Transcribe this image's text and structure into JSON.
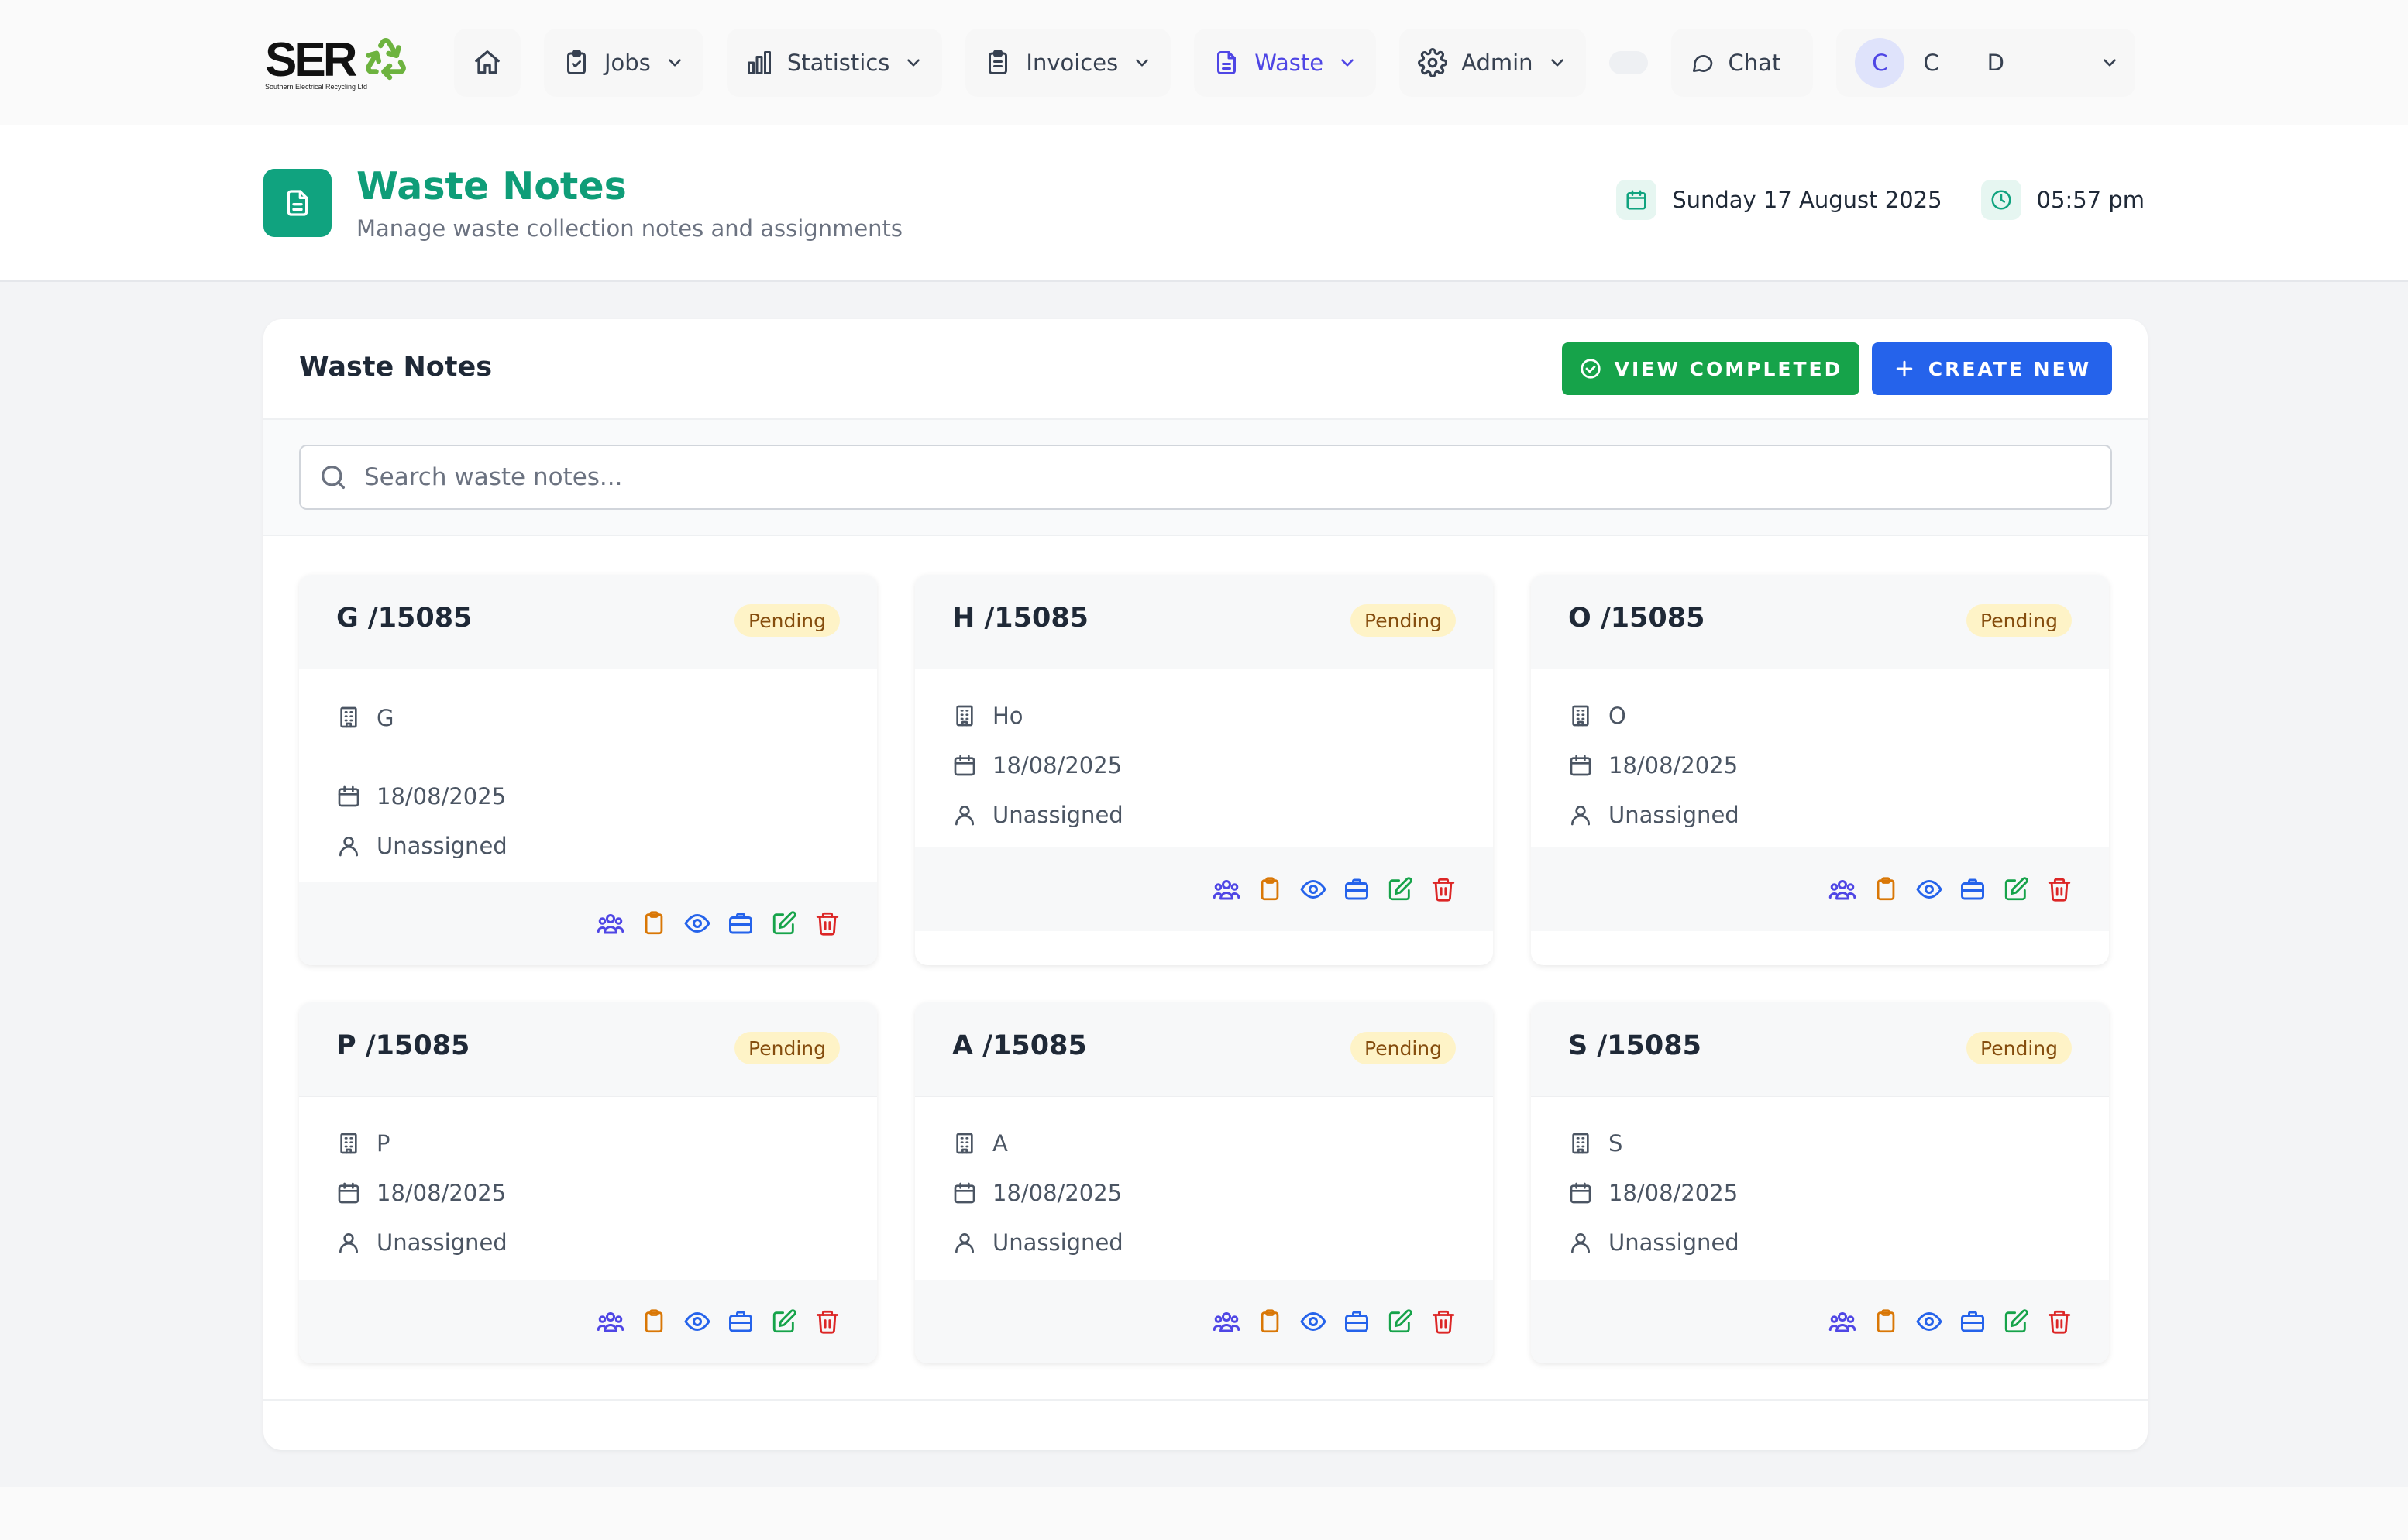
{
  "brand": {
    "logo_text": "SER",
    "logo_subtitle": "Southern Electrical Recycling Ltd"
  },
  "nav": {
    "items": [
      {
        "label": "Jobs"
      },
      {
        "label": "Statistics"
      },
      {
        "label": "Invoices"
      },
      {
        "label": "Waste"
      },
      {
        "label": "Admin"
      }
    ],
    "chat_label": "Chat",
    "user": {
      "avatar_initial": "C",
      "first": "C",
      "last": "D"
    }
  },
  "header": {
    "title": "Waste Notes",
    "subtitle": "Manage waste collection notes and assignments",
    "date": "Sunday 17 August 2025",
    "time": "05:57 pm"
  },
  "panel": {
    "title": "Waste Notes",
    "view_completed_label": "VIEW COMPLETED",
    "create_new_label": "CREATE NEW",
    "search_placeholder": "Search waste notes..."
  },
  "cards": [
    {
      "ref": "G /15085",
      "status": "Pending",
      "company": "G",
      "date": "18/08/2025",
      "assignee": "Unassigned"
    },
    {
      "ref": "H /15085",
      "status": "Pending",
      "company": "Ho",
      "date": "18/08/2025",
      "assignee": "Unassigned"
    },
    {
      "ref": "O /15085",
      "status": "Pending",
      "company": "O",
      "date": "18/08/2025",
      "assignee": "Unassigned"
    },
    {
      "ref": "P /15085",
      "status": "Pending",
      "company": "P",
      "date": "18/08/2025",
      "assignee": "Unassigned"
    },
    {
      "ref": "A /15085",
      "status": "Pending",
      "company": "A",
      "date": "18/08/2025",
      "assignee": "Unassigned"
    },
    {
      "ref": "S /15085",
      "status": "Pending",
      "company": "S",
      "date": "18/08/2025",
      "assignee": "Unassigned"
    }
  ],
  "icons": {
    "home": "home-icon",
    "jobs": "clipboard-check-icon",
    "statistics": "bar-chart-icon",
    "invoices": "receipt-icon",
    "waste": "document-icon",
    "admin": "gear-icon",
    "chat": "chat-bubble-icon",
    "chevron": "chevron-down-icon",
    "calendar": "calendar-icon",
    "clock": "clock-icon",
    "search": "search-icon",
    "building": "building-icon",
    "user": "user-icon",
    "actions": [
      "users-icon",
      "clipboard-icon",
      "eye-icon",
      "briefcase-icon",
      "edit-icon",
      "trash-icon"
    ]
  },
  "colors": {
    "brand_green": "#0f9d78",
    "nav_active": "#4f46e5",
    "btn_green": "#16a34a",
    "btn_blue": "#2563eb",
    "badge_bg": "#fef3c7",
    "badge_text": "#854d0e",
    "action_users": "#4f46e5",
    "action_clipboard": "#d97706",
    "action_eye": "#2563eb",
    "action_briefcase": "#2563eb",
    "action_edit": "#16a34a",
    "action_trash": "#dc2626"
  }
}
